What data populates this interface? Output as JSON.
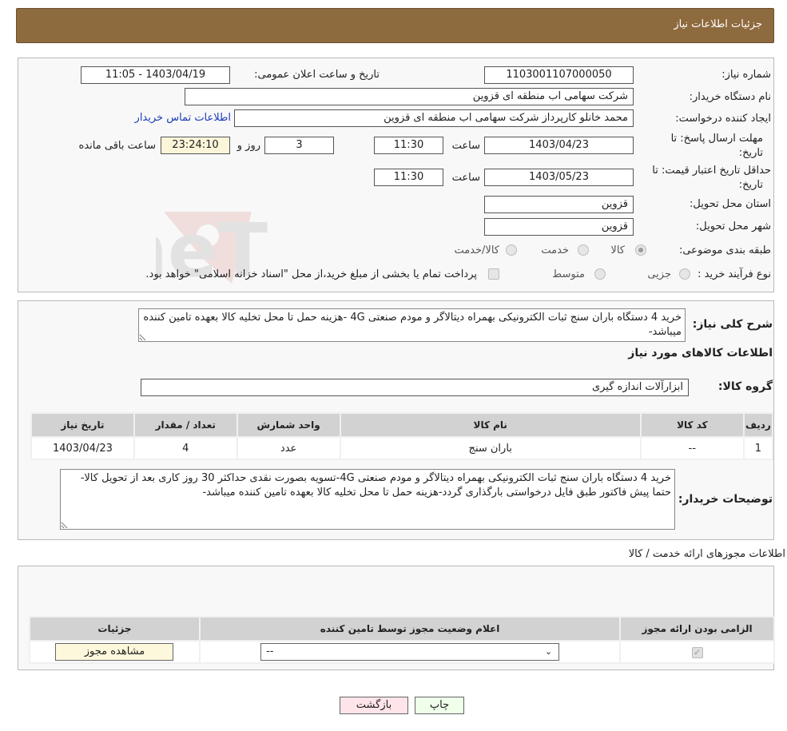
{
  "header": {
    "title": "جزئیات اطلاعات نیاز"
  },
  "need_number": {
    "label": "شماره نیاز:",
    "value": "1103001107000050"
  },
  "announce": {
    "label": "تاریخ و ساعت اعلان عمومی:",
    "value": "1403/04/19 - 11:05"
  },
  "buyer_org": {
    "label": "نام دستگاه خریدار:",
    "value": "شرکت سهامی اب منطقه ای قزوین"
  },
  "requester": {
    "label": "ایجاد کننده درخواست:",
    "value": "محمد خانلو کارپرداز شرکت سهامی اب منطقه ای قزوین",
    "contact_link": "اطلاعات تماس خریدار"
  },
  "deadline": {
    "label_line1": "مهلت ارسال پاسخ: تا",
    "label_line2": "تاریخ:",
    "date": "1403/04/23",
    "time_label": "ساعت",
    "time": "11:30",
    "days": "3",
    "days_label": "روز و",
    "remaining": "23:24:10",
    "remaining_label": "ساعت باقی مانده"
  },
  "validity": {
    "label_line1": "حداقل تاریخ اعتبار قیمت: تا",
    "label_line2": "تاریخ:",
    "date": "1403/05/23",
    "time_label": "ساعت",
    "time": "11:30"
  },
  "province": {
    "label": "استان محل تحویل:",
    "value": "قزوین"
  },
  "city": {
    "label": "شهر محل تحویل:",
    "value": "قزوین"
  },
  "category": {
    "label": "طبقه بندی موضوعی:",
    "options": [
      "کالا",
      "خدمت",
      "کالا/خدمت"
    ],
    "selected": "کالا"
  },
  "process": {
    "label": "نوع فرآیند خرید :",
    "options": [
      "جزیی",
      "متوسط"
    ],
    "note": "پرداخت تمام یا بخشی از مبلغ خرید،از محل \"اسناد خزانه اسلامی\" خواهد بود."
  },
  "summary": {
    "label": "شرح کلی نیاز:",
    "text": "خرید 4 دستگاه باران سنج ثبات الکترونیکی بهمراه دیتالاگر و مودم صنعتی 4G -هزینه حمل تا محل تخلیه کالا بعهده تامین کننده میباشد-"
  },
  "goods_title": "اطلاعات کالاهای مورد نیاز",
  "goods_group": {
    "label": "گروه کالا:",
    "value": "ابزارآلات اندازه گیری"
  },
  "goods_table": {
    "headers": [
      "ردیف",
      "کد کالا",
      "نام کالا",
      "واحد شمارش",
      "تعداد / مقدار",
      "تاریخ نیاز"
    ],
    "rows": [
      [
        "1",
        "--",
        "باران سنج",
        "عدد",
        "4",
        "1403/04/23"
      ]
    ]
  },
  "buyer_notes": {
    "label": "توضیحات خریدار:",
    "text": "خرید 4 دستگاه باران سنج ثبات الکترونیکی بهمراه دیتالاگر و مودم صنعتی 4G-تسویه بصورت نقدی حداکثر 30 روز کاری بعد از تحویل کالا- حتما پیش فاکتور طبق فایل درخواستی بارگذاری گردد-هزینه حمل تا محل تخلیه کالا بعهده تامین کننده میباشد-"
  },
  "permits": {
    "title": "اطلاعات مجوزهای ارائه خدمت / کالا",
    "headers": [
      "الزامی بودن ارائه مجوز",
      "اعلام وضعیت مجوز توسط تامین کننده",
      "جزئیات"
    ],
    "select_value": "--",
    "view_button": "مشاهده مجوز"
  },
  "buttons": {
    "print": "چاپ",
    "back": "بازگشت"
  },
  "watermark_text": "AriaTender.neT"
}
